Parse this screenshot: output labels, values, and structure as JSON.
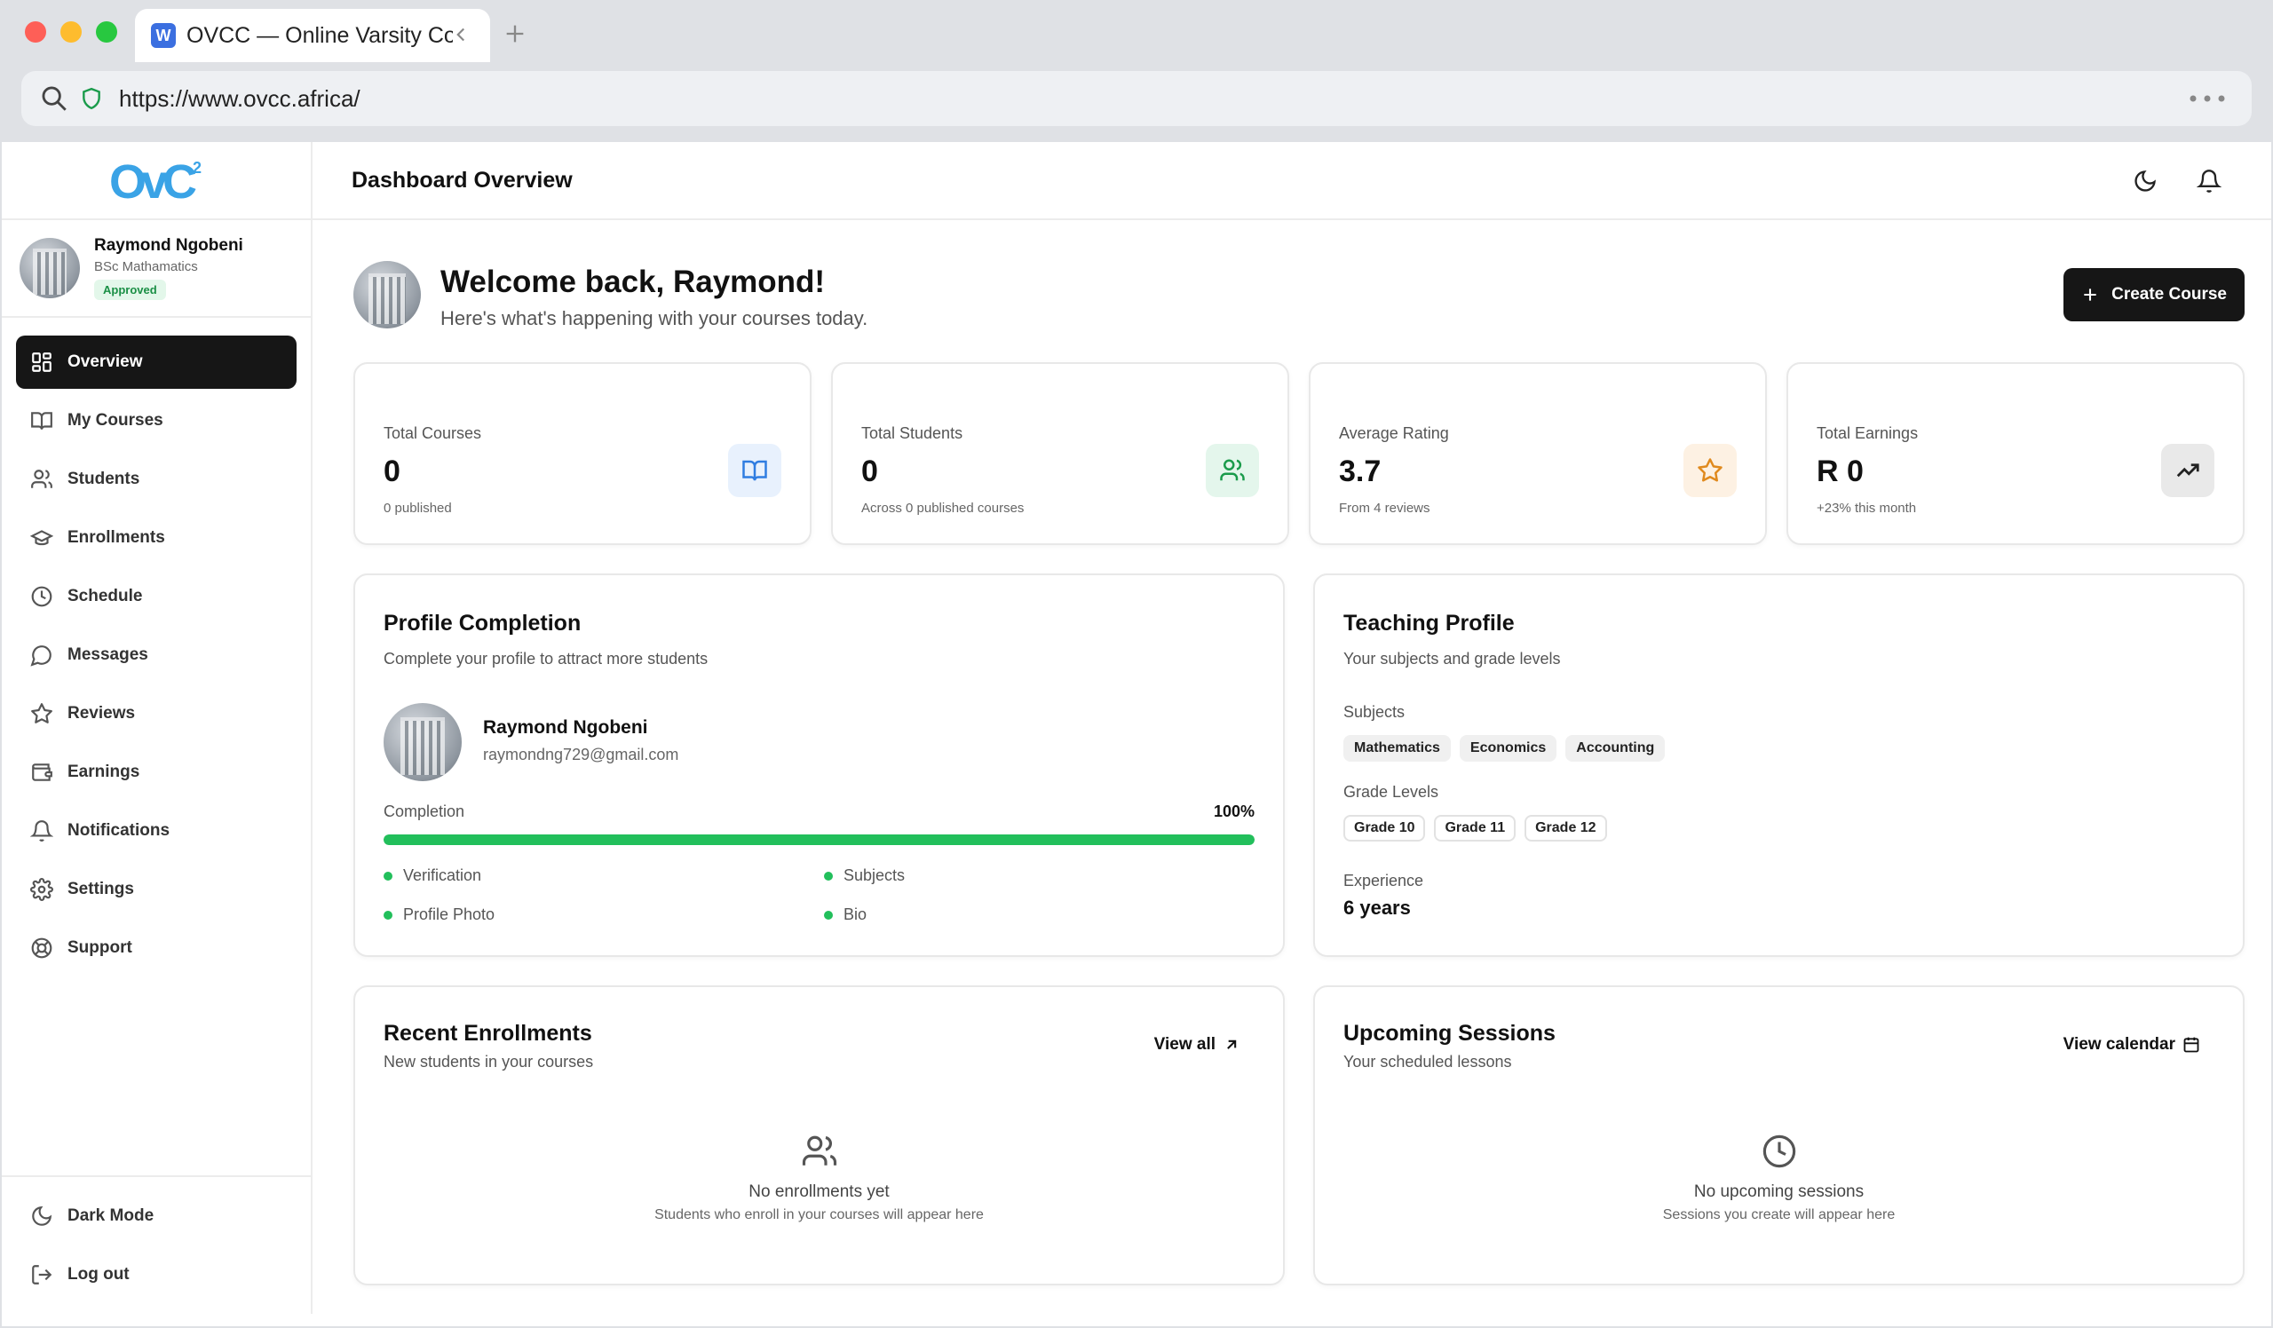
{
  "browser": {
    "tab_title": "OVCC — Online Varsity Coll",
    "tab_favicon": "W",
    "url": "https://www.ovcc.africa/"
  },
  "brand": {
    "logo_text": "OvC",
    "logo_sup": "2",
    "logo_color": "#3aa3e6"
  },
  "user": {
    "name": "Raymond Ngobeni",
    "degree": "BSc Mathamatics",
    "status": "Approved",
    "email": "raymondng729@gmail.com"
  },
  "nav": {
    "items": [
      {
        "label": "Overview",
        "icon": "grid-icon"
      },
      {
        "label": "My Courses",
        "icon": "book-icon"
      },
      {
        "label": "Students",
        "icon": "users-icon"
      },
      {
        "label": "Enrollments",
        "icon": "graduation-cap-icon"
      },
      {
        "label": "Schedule",
        "icon": "clock-icon"
      },
      {
        "label": "Messages",
        "icon": "message-icon"
      },
      {
        "label": "Reviews",
        "icon": "star-icon"
      },
      {
        "label": "Earnings",
        "icon": "wallet-icon"
      },
      {
        "label": "Notifications",
        "icon": "bell-icon"
      },
      {
        "label": "Settings",
        "icon": "gear-icon"
      },
      {
        "label": "Support",
        "icon": "lifebuoy-icon"
      }
    ],
    "dark_mode": "Dark Mode",
    "logout": "Log out"
  },
  "header": {
    "title": "Dashboard Overview"
  },
  "welcome": {
    "title": "Welcome back, Raymond!",
    "subtitle": "Here's what's happening with your courses today.",
    "create_button": "Create Course"
  },
  "stats": [
    {
      "label": "Total Courses",
      "value": "0",
      "note": "0 published",
      "icon": "book-icon",
      "color": "#2f7de1"
    },
    {
      "label": "Total Students",
      "value": "0",
      "note": "Across 0 published courses",
      "icon": "users-icon",
      "color": "#1a9b4b"
    },
    {
      "label": "Average Rating",
      "value": "3.7",
      "note": "From 4 reviews",
      "icon": "star-icon",
      "color": "#e08a1e"
    },
    {
      "label": "Total Earnings",
      "value": "R 0",
      "note": "+23% this month",
      "icon": "trending-up-icon",
      "color": "#222222"
    }
  ],
  "profile_completion": {
    "title": "Profile Completion",
    "subtitle": "Complete your profile to attract more students",
    "completion_label": "Completion",
    "percent": "100%",
    "progress": 1.0,
    "items": [
      "Verification",
      "Subjects",
      "Profile Photo",
      "Bio"
    ]
  },
  "teaching_profile": {
    "title": "Teaching Profile",
    "subtitle": "Your subjects and grade levels",
    "subjects_label": "Subjects",
    "subjects": [
      "Mathematics",
      "Economics",
      "Accounting"
    ],
    "grades_label": "Grade Levels",
    "grades": [
      "Grade 10",
      "Grade 11",
      "Grade 12"
    ],
    "experience_label": "Experience",
    "experience": "6 years"
  },
  "recent_enrollments": {
    "title": "Recent Enrollments",
    "subtitle": "New students in your courses",
    "link": "View all",
    "empty_title": "No enrollments yet",
    "empty_sub": "Students who enroll in your courses will appear here"
  },
  "upcoming_sessions": {
    "title": "Upcoming Sessions",
    "subtitle": "Your scheduled lessons",
    "link": "View calendar",
    "empty_title": "No upcoming sessions",
    "empty_sub": "Sessions you create will appear here"
  }
}
